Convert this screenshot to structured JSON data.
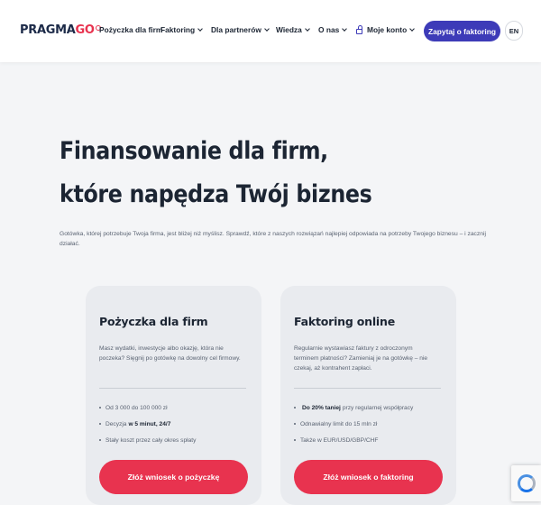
{
  "header": {
    "logo_main": "PRAGMA",
    "logo_accent": "GO",
    "nav": [
      {
        "label": "Pożyczka dla firm",
        "has_dropdown": false
      },
      {
        "label": "Faktoring",
        "has_dropdown": true
      },
      {
        "label": "Dla partnerów",
        "has_dropdown": true
      },
      {
        "label": "Wiedza",
        "has_dropdown": true
      },
      {
        "label": "O nas",
        "has_dropdown": true
      },
      {
        "label": "Moje konto",
        "has_dropdown": true,
        "icon": "lock-icon"
      }
    ],
    "cta_label": "Zapytaj o faktoring",
    "lang_label": "EN"
  },
  "hero": {
    "title_line1": "Finansowanie dla firm,",
    "title_line2": "które napędza Twój biznes",
    "description": "Gotówka, której potrzebuje Twoja firma, jest bliżej niż myślisz. Sprawdź, które z naszych rozwiązań najlepiej odpowiada na potrzeby Twojego biznesu – i zacznij działać."
  },
  "cards": [
    {
      "title": "Pożyczka dla firm",
      "description": "Masz wydatki, inwestycje albo okazję, która nie poczeka? Sięgnij po gotówkę na dowolny cel firmowy.",
      "features": [
        {
          "pre": "Od 3 000 do 100 000 zł",
          "bold": "",
          "post": ""
        },
        {
          "pre": "Decyzja",
          "bold": "w 5 minut, 24/7",
          "post": ""
        },
        {
          "pre": "Stały koszt przez cały okres spłaty",
          "bold": "",
          "post": ""
        }
      ],
      "button_label": "Złóż wniosek o pożyczkę"
    },
    {
      "title": "Faktoring online",
      "description": "Regularnie wystawiasz faktury z odroczonym terminem płatności? Zamieniaj je na gotówkę – nie czekaj, aż kontrahent zapłaci.",
      "features": [
        {
          "pre": "",
          "bold": "Do 20% taniej",
          "post": "przy regularnej współpracy"
        },
        {
          "pre": "Odnawialny limit do 15 mln zł",
          "bold": "",
          "post": ""
        },
        {
          "pre": "Także w EUR/USD/GBP/CHF",
          "bold": "",
          "post": ""
        }
      ],
      "button_label": "Złóż wniosek o faktoring"
    }
  ],
  "colors": {
    "brand_navy": "#1c2a48",
    "accent_red": "#e8334f",
    "accent_purple": "#3d3bb8"
  }
}
